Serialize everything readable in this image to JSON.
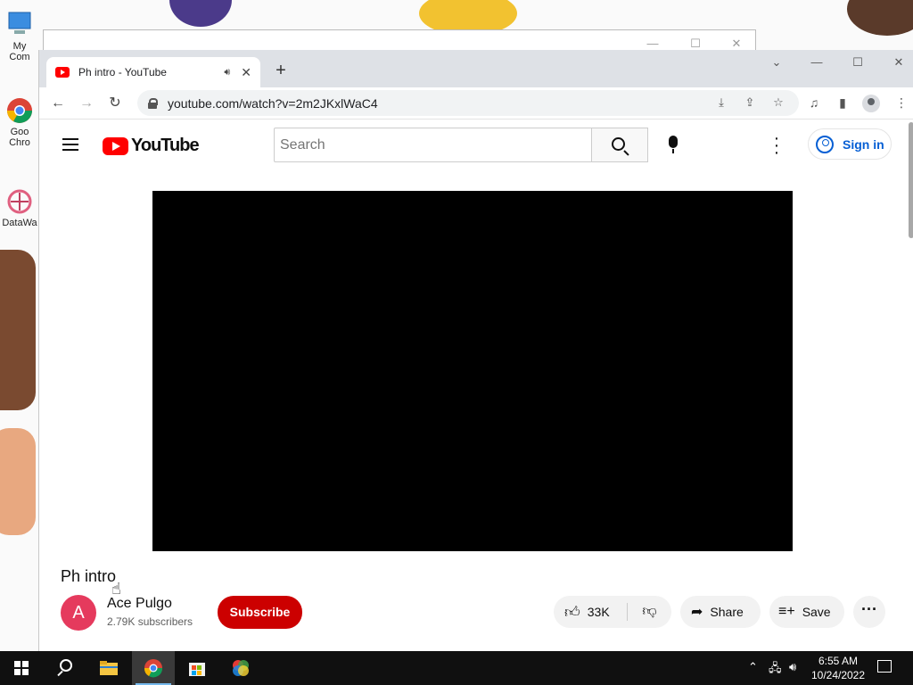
{
  "desktop": {
    "icons": [
      {
        "label": "My Com",
        "name": "my-computer"
      },
      {
        "label": "Goo Chro",
        "name": "google-chrome"
      },
      {
        "label": "DataWa",
        "name": "datawave"
      }
    ]
  },
  "background_window": {
    "title": ""
  },
  "browser": {
    "tab_title": "Ph intro - YouTube",
    "url": "youtube.com/watch?v=2m2JKxlWaC4",
    "new_tab_label": "+"
  },
  "youtube": {
    "logo_text": "YouTube",
    "search_placeholder": "Search",
    "signin_label": "Sign in",
    "video": {
      "title": "Ph intro",
      "channel": "Ace Pulgo",
      "avatar_letter": "A",
      "subscribers": "2.79K subscribers",
      "subscribe_label": "Subscribe",
      "likes": "33K",
      "share_label": "Share",
      "save_label": "Save"
    }
  },
  "taskbar": {
    "time": "6:55 AM",
    "date": "10/24/2022"
  },
  "colors": {
    "youtube_red": "#ff0000",
    "subscribe_red": "#cc0000",
    "signin_blue": "#065fd4",
    "avatar": "#e53a5d",
    "taskbar": "#101010"
  }
}
